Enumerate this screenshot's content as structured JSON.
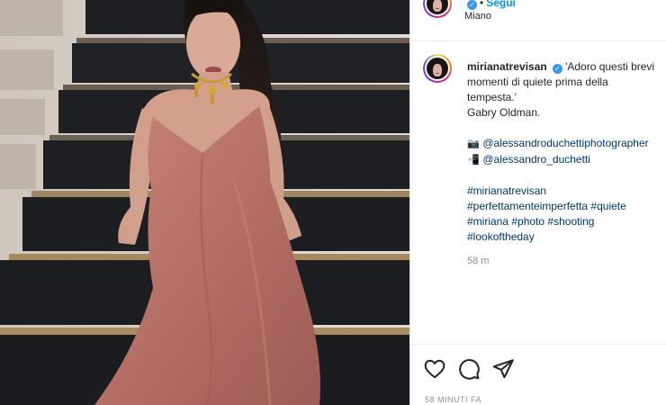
{
  "post": {
    "username": "mirianatrevisan",
    "follow_label": "Segui",
    "location": "Miano"
  },
  "caption": {
    "username": "mirianatrevisan",
    "lines": [
      "'Adoro questi brevi",
      "momenti di quiete prima della",
      "tempesta.'",
      "Gabry Oldman."
    ],
    "credits": [
      {
        "icon": "camera-emoji",
        "handle": "@alessandroduchettiphotographer"
      },
      {
        "icon": "phone-emoji",
        "handle": "@alessandro_duchetti"
      }
    ],
    "hashtags_lines": [
      [
        "#mirianatrevisan"
      ],
      [
        "#perfettamenteimperfetta",
        "#quiete"
      ],
      [
        "#miriana",
        "#photo",
        "#shooting"
      ],
      [
        "#lookoftheday"
      ]
    ],
    "time_ago": "58 m"
  },
  "footer": {
    "date_label": "58 MINUTI FA"
  },
  "colors": {
    "link": "#00376b",
    "follow": "#0095f6",
    "verified": "#3897f0",
    "muted": "#8e8e8e"
  },
  "icons": {
    "like": "heart-icon",
    "comment": "comment-icon",
    "share": "send-icon"
  }
}
